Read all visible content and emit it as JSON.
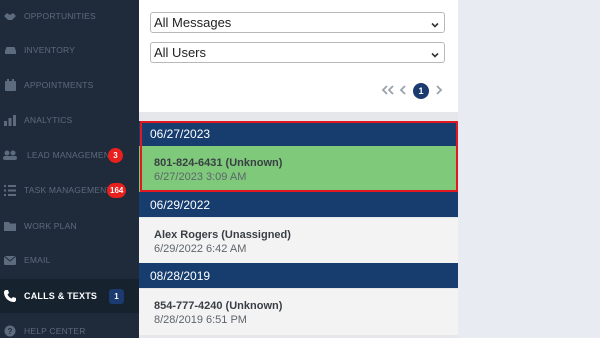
{
  "sidebar": {
    "items": [
      {
        "label": "OPPORTUNITIES",
        "icon": "handshake-icon"
      },
      {
        "label": "INVENTORY",
        "icon": "car-icon"
      },
      {
        "label": "APPOINTMENTS",
        "icon": "calendar-icon"
      },
      {
        "label": "ANALYTICS",
        "icon": "chart-icon"
      },
      {
        "label": "LEAD MANAGEMENT",
        "icon": "users-icon",
        "badge": "3"
      },
      {
        "label": "TASK MANAGEMENT",
        "icon": "checklist-icon",
        "badge": "164"
      },
      {
        "label": "WORK PLAN",
        "icon": "folder-icon"
      },
      {
        "label": "EMAIL",
        "icon": "envelope-icon"
      },
      {
        "label": "CALLS & TEXTS",
        "icon": "phone-icon",
        "badge": "1",
        "active": true
      },
      {
        "label": "HELP CENTER",
        "icon": "help-icon"
      }
    ]
  },
  "filters": {
    "messages_select": "All Messages",
    "users_select": "All Users"
  },
  "pagination": {
    "current_page": "1"
  },
  "groups": [
    {
      "date": "06/27/2023",
      "entries": [
        {
          "name": "801-824-6431 (Unknown)",
          "time": "6/27/2023 3:09 AM",
          "selected": true
        }
      ]
    },
    {
      "date": "06/29/2022",
      "entries": [
        {
          "name": "Alex Rogers (Unassigned)",
          "time": "6/29/2022 6:42 AM"
        }
      ]
    },
    {
      "date": "08/28/2019",
      "entries": [
        {
          "name": "854-777-4240 (Unknown)",
          "time": "8/28/2019 6:51 PM"
        }
      ]
    }
  ],
  "colors": {
    "sidebar_bg": "#1f2b3a",
    "header_bg": "#163d6e",
    "selected_row": "#7ec97a",
    "highlight_border": "#e01820",
    "badge_red": "#e8201e",
    "badge_blue": "#1a3a70"
  }
}
